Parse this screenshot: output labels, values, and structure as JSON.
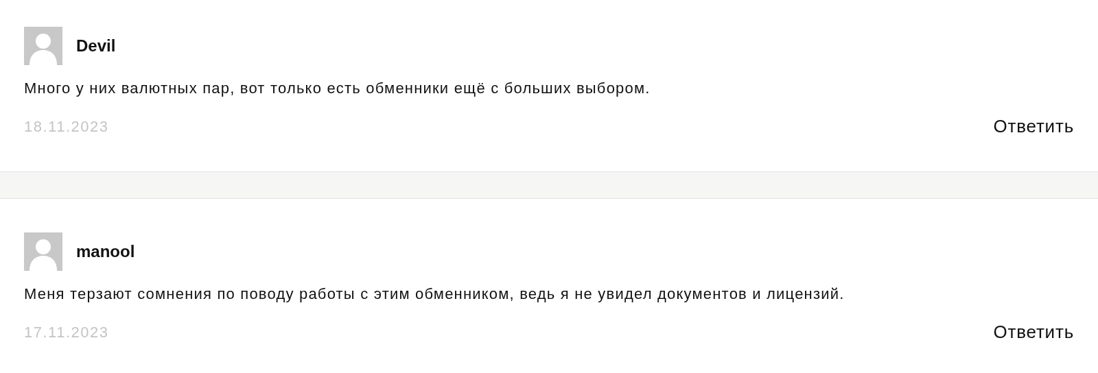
{
  "comments": [
    {
      "author": "Devil",
      "text": "Много у них валютных пар, вот только есть обменники ещё с больших выбором.",
      "date": "18.11.2023",
      "reply": "Ответить"
    },
    {
      "author": "manool",
      "text": "Меня терзают сомнения по поводу работы с этим обменником, ведь я не увидел документов и лицензий.",
      "date": "17.11.2023",
      "reply": "Ответить"
    }
  ]
}
